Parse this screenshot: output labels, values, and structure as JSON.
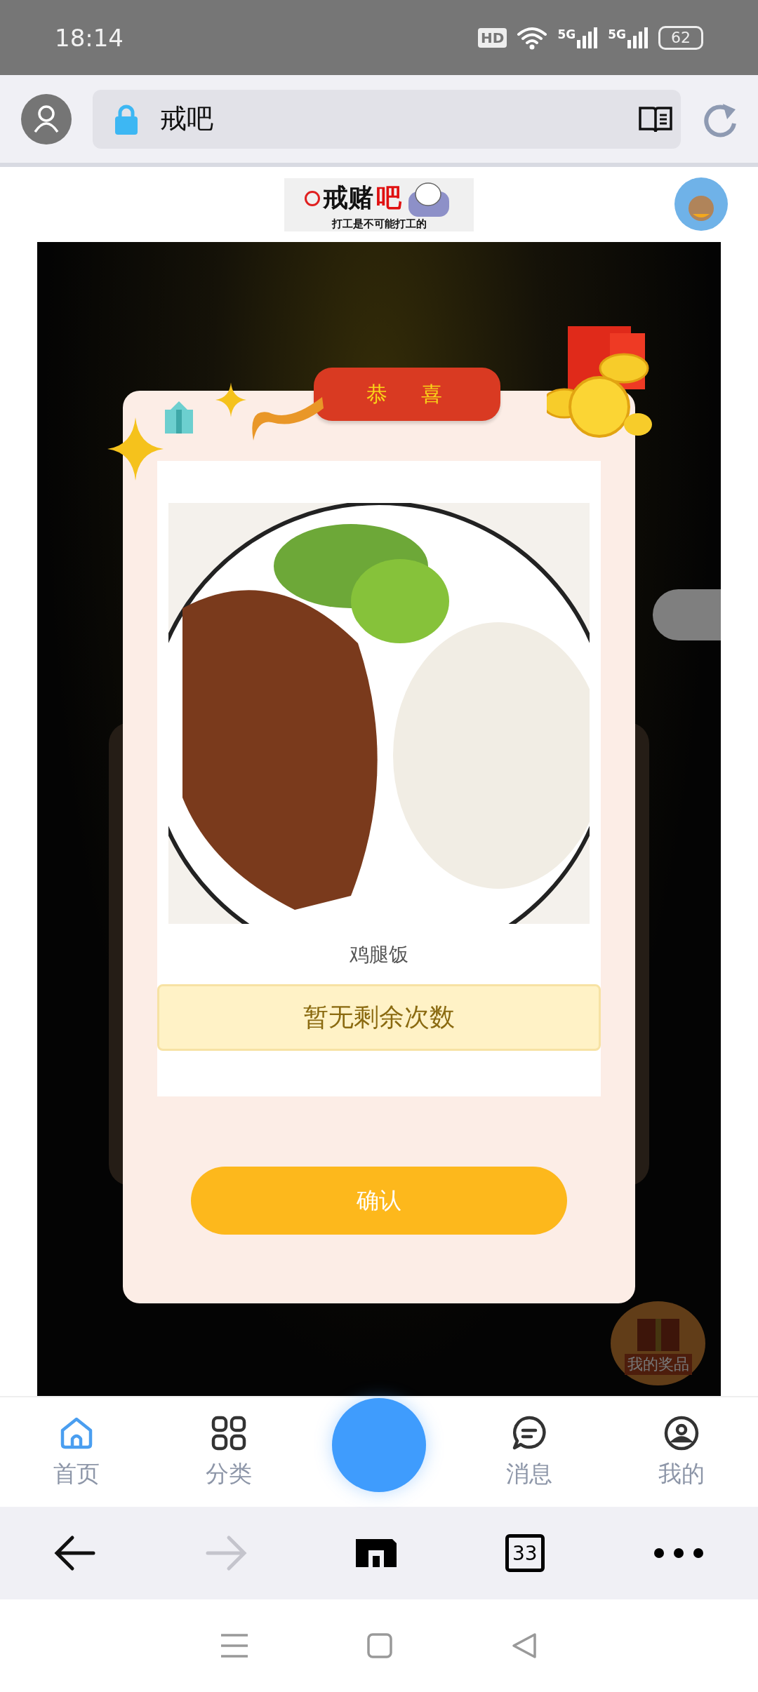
{
  "status_bar": {
    "time": "18:14",
    "hd_label": "HD",
    "signals": [
      {
        "label": "5G"
      },
      {
        "label": "5G"
      }
    ],
    "battery": "62"
  },
  "address_bar": {
    "title": "戒吧"
  },
  "header": {
    "logo_title": "戒赌",
    "logo_accent": "吧",
    "logo_subtitle": "打工是不可能打工的"
  },
  "modal": {
    "title": "恭　喜",
    "prize_name": "鸡腿饭",
    "notice": "暂无剩余次数",
    "confirm": "确认"
  },
  "floating_badge": {
    "label": "我的奖品"
  },
  "tabs": [
    {
      "label": "首页",
      "kind": "home",
      "selected": true
    },
    {
      "label": "分类",
      "kind": "grid",
      "selected": false
    },
    {
      "label": "消息",
      "kind": "chat",
      "selected": false
    },
    {
      "label": "我的",
      "kind": "user",
      "selected": false
    }
  ],
  "browser_toolbar": {
    "tab_count": "33",
    "forward_disabled": true
  }
}
